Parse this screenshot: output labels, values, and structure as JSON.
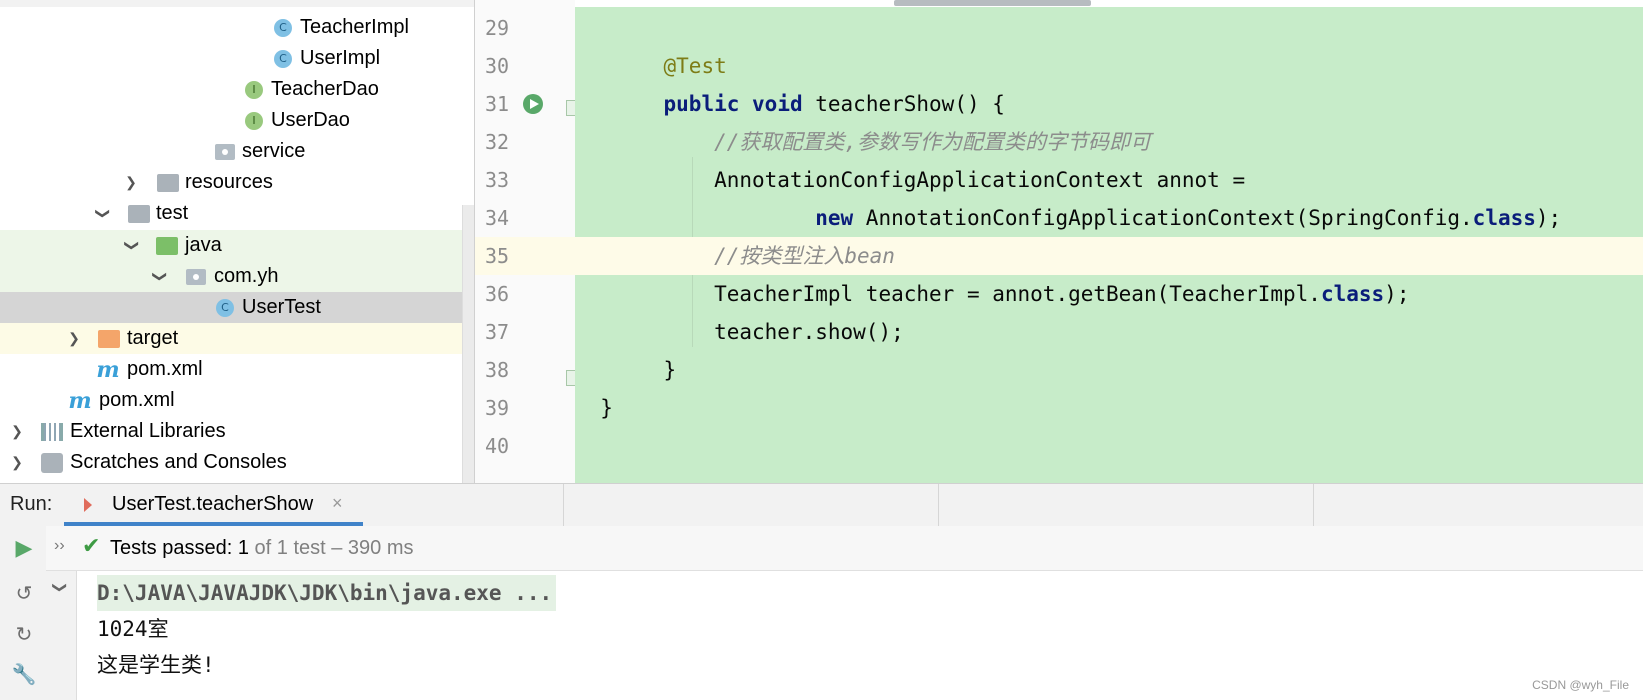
{
  "project_tree": {
    "items": [
      {
        "label": "TeacherImpl",
        "icon": "class-icon"
      },
      {
        "label": "UserImpl",
        "icon": "class-icon"
      },
      {
        "label": "TeacherDao",
        "icon": "interface-icon"
      },
      {
        "label": "UserDao",
        "icon": "interface-icon"
      },
      {
        "label": "service",
        "icon": "package-icon"
      },
      {
        "label": "resources",
        "icon": "resources-folder-icon"
      },
      {
        "label": "test",
        "icon": "folder-icon"
      },
      {
        "label": "java",
        "icon": "test-source-folder-icon"
      },
      {
        "label": "com.yh",
        "icon": "package-icon"
      },
      {
        "label": "UserTest",
        "icon": "test-class-icon"
      },
      {
        "label": "target",
        "icon": "excluded-folder-icon"
      },
      {
        "label": "pom.xml",
        "icon": "maven-icon"
      },
      {
        "label": "pom.xml",
        "icon": "maven-icon"
      },
      {
        "label": "External Libraries",
        "icon": "libraries-icon"
      },
      {
        "label": "Scratches and Consoles",
        "icon": "scratches-icon"
      }
    ],
    "selected": "UserTest"
  },
  "editor": {
    "line_numbers": [
      "29",
      "30",
      "31",
      "32",
      "33",
      "34",
      "35",
      "36",
      "37",
      "38",
      "39",
      "40"
    ],
    "lines": {
      "l30": "@Test",
      "l31_kw1": "public",
      "l31_kw2": "void",
      "l31_rest": " teacherShow() {",
      "l32": "//获取配置类,参数写作为配置类的字节码即可",
      "l33": "AnnotationConfigApplicationContext annot =",
      "l34_kw": "new",
      "l34_rest": " AnnotationConfigApplicationContext(SpringConfig.",
      "l34_kw2": "class",
      "l34_end": ");",
      "l35": "//按类型注入bean",
      "l36_rest": "TeacherImpl teacher = annot.getBean(TeacherImpl.",
      "l36_kw": "class",
      "l36_end": ");",
      "l37": "teacher.show();",
      "l38": "}",
      "l39": "}"
    },
    "current_line": "35"
  },
  "run_panel": {
    "label": "Run:",
    "tab_title": "UserTest.teacherShow",
    "tab_close": "×",
    "status_main": "Tests passed: 1",
    "status_sub": " of 1 test – 390 ms",
    "console": [
      "D:\\JAVA\\JAVAJDK\\JDK\\bin\\java.exe ...",
      "1024室",
      "这是学生类!"
    ]
  },
  "watermark": "CSDN @wyh_File"
}
